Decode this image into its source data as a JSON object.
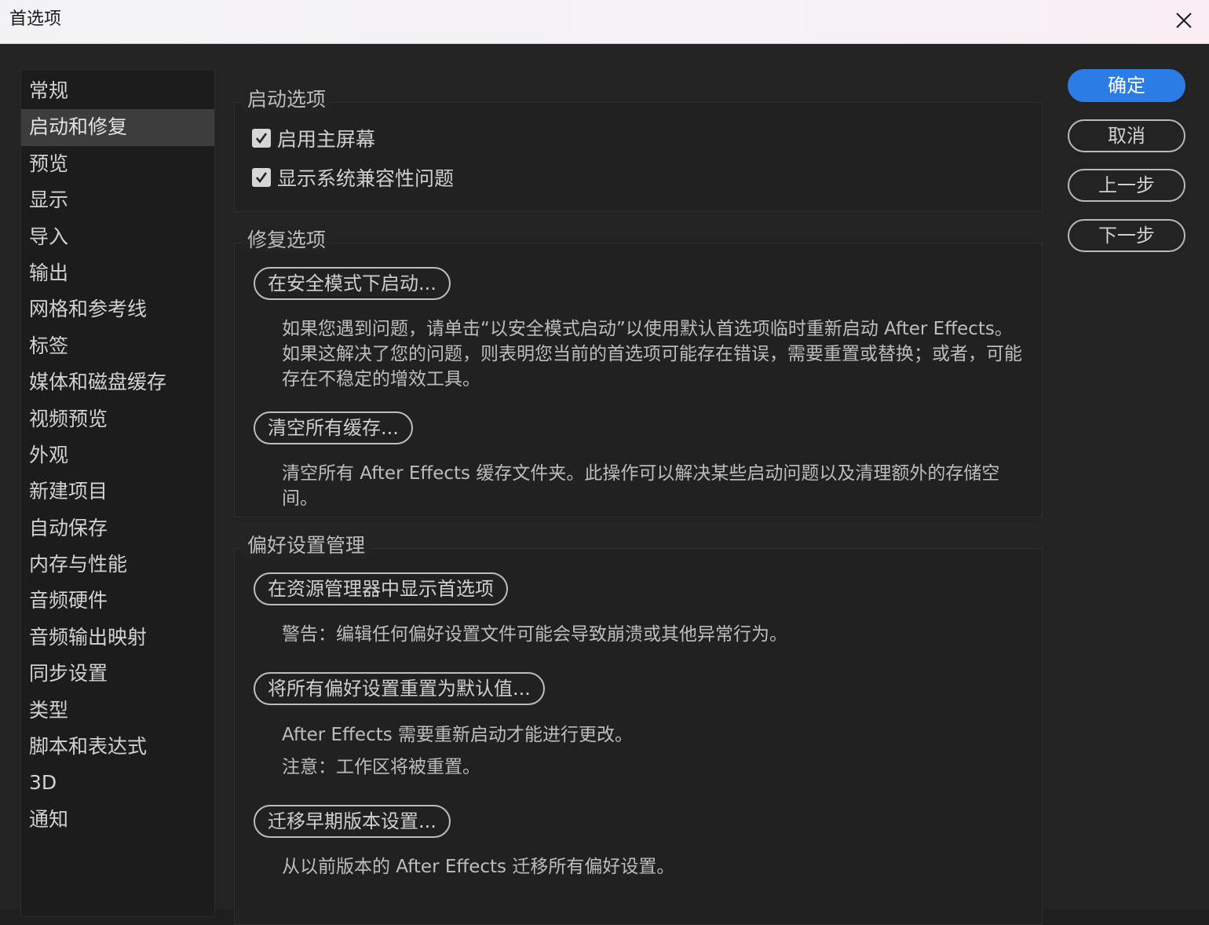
{
  "window": {
    "title": "首选项",
    "close_icon": "close-icon"
  },
  "sidebar": {
    "items": [
      {
        "label": "常规",
        "active": false
      },
      {
        "label": "启动和修复",
        "active": true
      },
      {
        "label": "预览",
        "active": false
      },
      {
        "label": "显示",
        "active": false
      },
      {
        "label": "导入",
        "active": false
      },
      {
        "label": "输出",
        "active": false
      },
      {
        "label": "网格和参考线",
        "active": false
      },
      {
        "label": "标签",
        "active": false
      },
      {
        "label": "媒体和磁盘缓存",
        "active": false
      },
      {
        "label": "视频预览",
        "active": false
      },
      {
        "label": "外观",
        "active": false
      },
      {
        "label": "新建项目",
        "active": false
      },
      {
        "label": "自动保存",
        "active": false
      },
      {
        "label": "内存与性能",
        "active": false
      },
      {
        "label": "音频硬件",
        "active": false
      },
      {
        "label": "音频输出映射",
        "active": false
      },
      {
        "label": "同步设置",
        "active": false
      },
      {
        "label": "类型",
        "active": false
      },
      {
        "label": "脚本和表达式",
        "active": false
      },
      {
        "label": "3D",
        "active": false
      },
      {
        "label": "通知",
        "active": false
      }
    ]
  },
  "startup": {
    "title": "启动选项",
    "enable_home_label": "启用主屏幕",
    "enable_home_checked": true,
    "show_compat_label": "显示系统兼容性问题",
    "show_compat_checked": true
  },
  "repair": {
    "title": "修复选项",
    "safe_mode_button": "在安全模式下启动...",
    "safe_mode_desc": "如果您遇到问题，请单击“以安全模式启动”以使用默认首选项临时重新启动 After Effects。如果这解决了您的问题，则表明您当前的首选项可能存在错误，需要重置或替换；或者，可能存在不稳定的增效工具。",
    "clear_cache_button": "清空所有缓存...",
    "clear_cache_desc": "清空所有 After Effects 缓存文件夹。此操作可以解决某些启动问题以及清理额外的存储空间。"
  },
  "prefs": {
    "title": "偏好设置管理",
    "show_in_explorer_button": "在资源管理器中显示首选项",
    "show_in_explorer_desc": "警告：编辑任何偏好设置文件可能会导致崩溃或其他异常行为。",
    "reset_button": "将所有偏好设置重置为默认值...",
    "reset_desc_1": "After Effects 需要重新启动才能进行更改。",
    "reset_desc_2": "注意：工作区将被重置。",
    "migrate_button": "迁移早期版本设置...",
    "migrate_desc": "从以前版本的 After Effects 迁移所有偏好设置。"
  },
  "actions": {
    "ok": "确定",
    "cancel": "取消",
    "previous": "上一步",
    "next": "下一步",
    "accent_color": "#2c7ce6"
  }
}
